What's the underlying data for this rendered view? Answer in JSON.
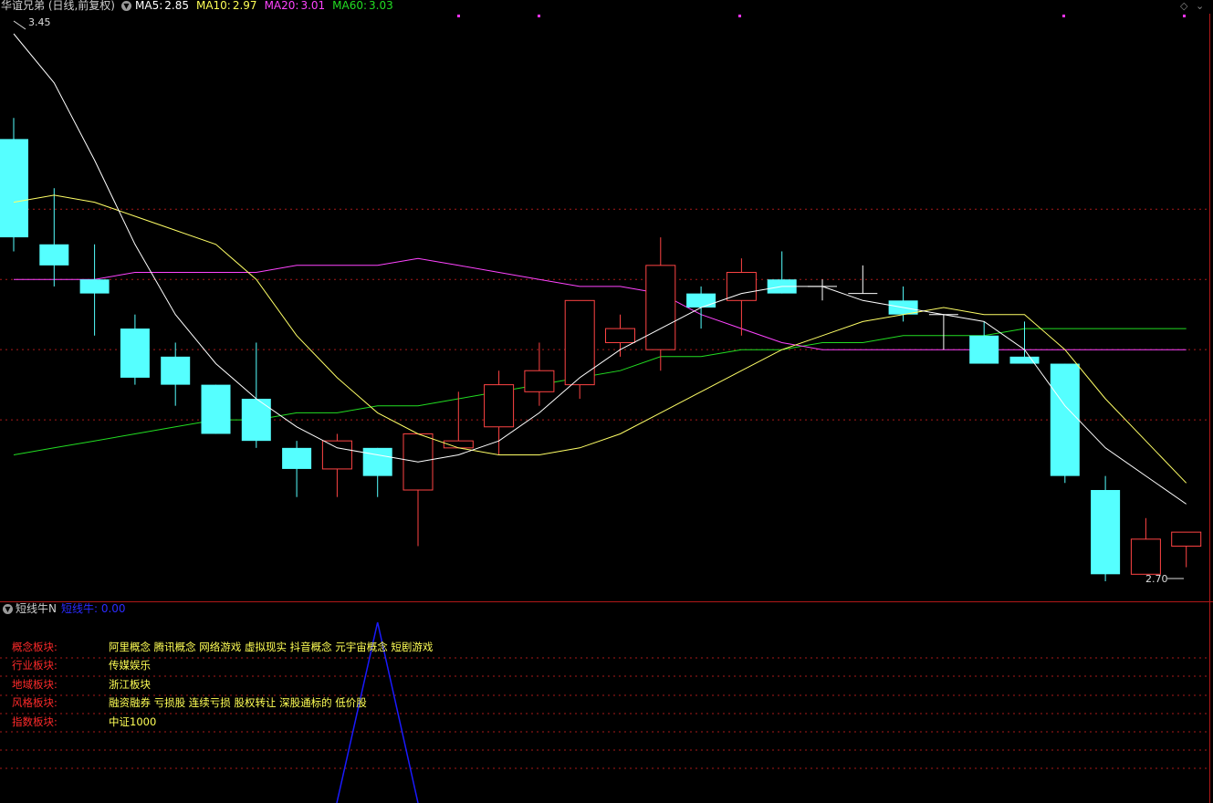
{
  "header": {
    "title": "华谊兄弟 (日线,前复权)",
    "ma5_label": "MA5:",
    "ma5_value": "2.85",
    "ma10_label": "MA10:",
    "ma10_value": "2.97",
    "ma20_label": "MA20:",
    "ma20_value": "3.01",
    "ma60_label": "MA60:",
    "ma60_value": "3.03"
  },
  "colors": {
    "up": "#ff4444",
    "down": "#55ffff",
    "ma5": "#ffffff",
    "ma10": "#ffff66",
    "ma20": "#ff44ff",
    "ma60": "#22dd22",
    "grid": "#a81a1a",
    "indicator": "#1a1aff"
  },
  "price_labels": {
    "high": "3.45",
    "low": "2.70"
  },
  "sub": {
    "title": "短线牛N",
    "value_label": "短线牛: 0.00"
  },
  "info_rows": [
    {
      "label": "概念板块:",
      "value": "阿里概念 腾讯概念 网络游戏 虚拟现实 抖音概念 元宇宙概念 短剧游戏"
    },
    {
      "label": "行业板块:",
      "value": "传媒娱乐"
    },
    {
      "label": "地域板块:",
      "value": "浙江板块"
    },
    {
      "label": "风格板块:",
      "value": "融资融券 亏损股 连续亏损 股权转让 深股通标的 低价股"
    },
    {
      "label": "指数板块:",
      "value": "中证1000"
    }
  ],
  "chart_data": {
    "type": "candlestick",
    "ohlc": [
      [
        3.3,
        3.33,
        3.16,
        3.14
      ],
      [
        3.15,
        3.23,
        3.12,
        3.09
      ],
      [
        3.1,
        3.15,
        3.08,
        3.02
      ],
      [
        3.03,
        3.05,
        2.96,
        2.95
      ],
      [
        2.99,
        3.01,
        2.95,
        2.92
      ],
      [
        2.95,
        2.95,
        2.88,
        2.88
      ],
      [
        2.93,
        3.01,
        2.87,
        2.86
      ],
      [
        2.86,
        2.87,
        2.83,
        2.79
      ],
      [
        2.83,
        2.88,
        2.87,
        2.79
      ],
      [
        2.86,
        2.86,
        2.82,
        2.79
      ],
      [
        2.8,
        2.8,
        2.88,
        2.72
      ],
      [
        2.86,
        2.94,
        2.87,
        2.86
      ],
      [
        2.89,
        2.97,
        2.95,
        2.85
      ],
      [
        2.94,
        3.01,
        2.97,
        2.92
      ],
      [
        2.95,
        3.06,
        3.07,
        2.93
      ],
      [
        3.01,
        3.05,
        3.03,
        2.99
      ],
      [
        3.0,
        3.16,
        3.12,
        2.97
      ],
      [
        3.08,
        3.09,
        3.06,
        3.03
      ],
      [
        3.07,
        3.13,
        3.11,
        3.02
      ],
      [
        3.1,
        3.14,
        3.08,
        3.08
      ],
      [
        3.09,
        3.1,
        3.09,
        3.07
      ],
      [
        3.08,
        3.12,
        3.08,
        3.08
      ],
      [
        3.07,
        3.09,
        3.05,
        3.04
      ],
      [
        3.05,
        3.05,
        3.05,
        3.0
      ],
      [
        3.02,
        3.04,
        2.98,
        2.98
      ],
      [
        2.99,
        3.04,
        2.98,
        2.98
      ],
      [
        2.98,
        2.98,
        2.82,
        2.81
      ],
      [
        2.8,
        2.82,
        2.68,
        2.67
      ],
      [
        2.68,
        2.76,
        2.73,
        2.68
      ],
      [
        2.72,
        2.73,
        2.74,
        2.69
      ]
    ],
    "ma5": [
      3.45,
      3.38,
      3.27,
      3.15,
      3.05,
      2.98,
      2.93,
      2.89,
      2.86,
      2.85,
      2.84,
      2.85,
      2.87,
      2.91,
      2.96,
      3.0,
      3.03,
      3.06,
      3.08,
      3.09,
      3.09,
      3.07,
      3.06,
      3.05,
      3.04,
      3.0,
      2.92,
      2.86,
      2.82,
      2.78
    ],
    "ma10": [
      3.21,
      3.22,
      3.21,
      3.19,
      3.17,
      3.15,
      3.1,
      3.02,
      2.96,
      2.91,
      2.88,
      2.86,
      2.85,
      2.85,
      2.86,
      2.88,
      2.91,
      2.94,
      2.97,
      3.0,
      3.02,
      3.04,
      3.05,
      3.06,
      3.05,
      3.05,
      3.0,
      2.93,
      2.87,
      2.81
    ],
    "ma20": [
      3.1,
      3.1,
      3.1,
      3.11,
      3.11,
      3.11,
      3.11,
      3.12,
      3.12,
      3.12,
      3.13,
      3.12,
      3.11,
      3.1,
      3.09,
      3.09,
      3.08,
      3.05,
      3.03,
      3.01,
      3.0,
      3.0,
      3.0,
      3.0,
      3.0,
      3.0,
      3.0,
      3.0,
      3.0,
      3.0
    ],
    "ma60": [
      2.85,
      2.86,
      2.87,
      2.88,
      2.89,
      2.9,
      2.9,
      2.91,
      2.91,
      2.92,
      2.92,
      2.93,
      2.94,
      2.95,
      2.96,
      2.97,
      2.99,
      2.99,
      3.0,
      3.0,
      3.01,
      3.01,
      3.02,
      3.02,
      3.02,
      3.03,
      3.03,
      3.03,
      3.03,
      3.03
    ],
    "ylim": [
      2.67,
      3.45
    ],
    "grid_prices": [
      3.2,
      3.1,
      3.0,
      2.9
    ],
    "indicator": {
      "name": "短线牛",
      "peak_value": 1.0
    }
  }
}
